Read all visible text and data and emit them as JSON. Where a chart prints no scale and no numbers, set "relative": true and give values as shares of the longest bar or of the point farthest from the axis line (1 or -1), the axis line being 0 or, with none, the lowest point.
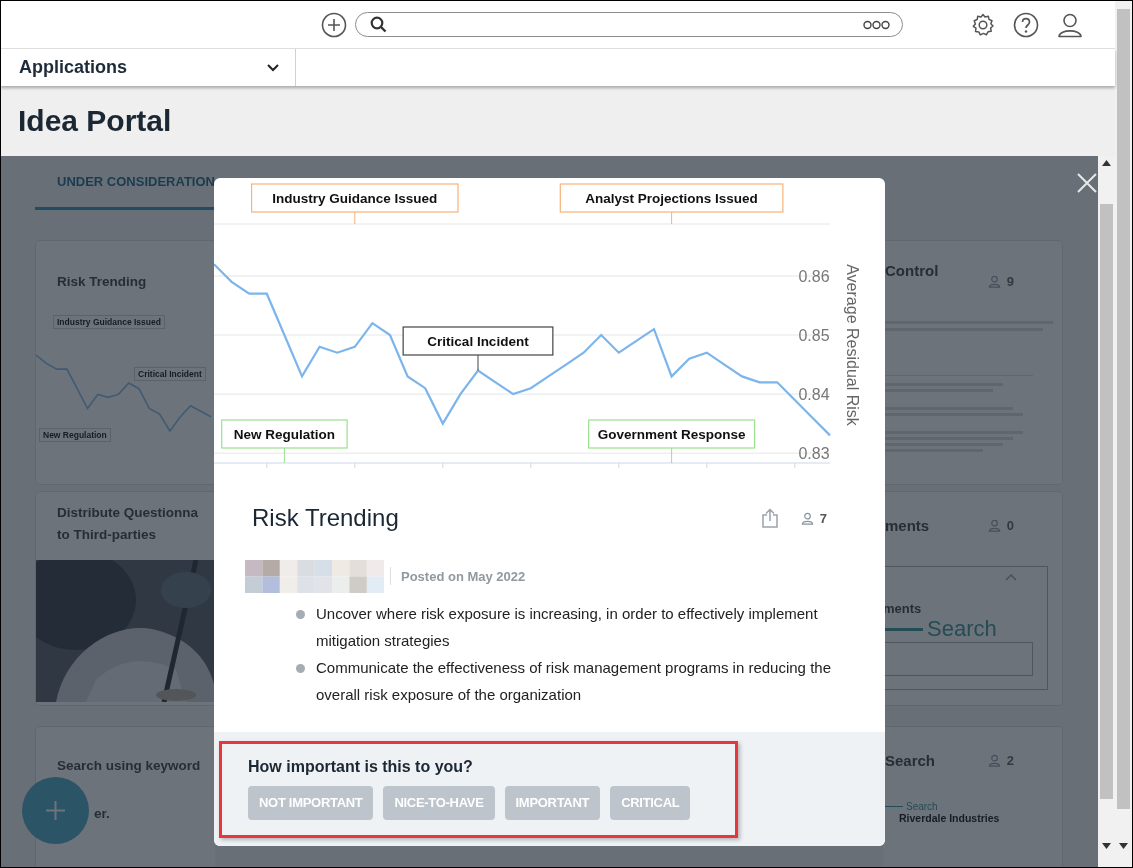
{
  "app_menu": {
    "label": "Applications"
  },
  "page_title": "Idea Portal",
  "tabs": [
    {
      "label": "UNDER CONSIDERATION",
      "selected": true
    }
  ],
  "left_cards": [
    {
      "kind": "chart",
      "title_lines": [
        "Risk Trending"
      ],
      "labels": [
        "Industry Guidance Issued",
        "Critical Incident",
        "New Regulation"
      ],
      "chart_data": {
        "type": "line",
        "relative": true,
        "categories": [
          null,
          null,
          null,
          null,
          null,
          null,
          null,
          null,
          null,
          null,
          null,
          null,
          null,
          null,
          null,
          null,
          null,
          null
        ],
        "series": [
          {
            "color": "#405a74",
            "values": [
              1,
              0.889,
              0.815,
              0.815,
              0.556,
              0.296,
              0.481,
              0.444,
              0.481,
              0.63,
              0.556,
              0.296,
              0.222,
              0,
              0.185,
              0.333,
              0.259,
              0.185
            ]
          }
        ]
      }
    },
    {
      "kind": "picture",
      "title_lines": [
        "Distribute Questionna",
        "to Third-parties"
      ]
    },
    {
      "kind": "text",
      "title_lines": [
        "Search using keyword",
        "er."
      ]
    }
  ],
  "right_cards": [
    {
      "kind": "text",
      "title": "Control",
      "votes": "9"
    },
    {
      "kind": "panel",
      "title": "ments",
      "votes": "0",
      "panel_title": "ments",
      "panel_search": "Search"
    },
    {
      "kind": "tabs",
      "title": "Search",
      "votes": "2",
      "panel_search": "Search",
      "panel_title": "Riverdale Industries"
    }
  ],
  "modal": {
    "chart_data": {
      "type": "line",
      "ylabel": "Average Residual Risk",
      "grid": true,
      "categories": [
        null,
        null,
        null,
        null,
        null,
        null,
        null,
        null,
        null,
        null,
        null,
        null,
        null,
        null,
        null,
        null,
        null,
        null,
        null,
        null,
        null,
        null,
        null,
        null,
        null,
        null,
        null,
        null,
        null,
        null,
        null,
        null,
        null,
        null,
        null,
        null
      ],
      "series": [
        {
          "color": "#7cb5ec",
          "values": [
            0.862,
            0.859,
            0.857,
            0.857,
            0.85,
            0.843,
            0.848,
            0.847,
            0.848,
            0.852,
            0.85,
            0.843,
            0.841,
            0.835,
            0.84,
            0.844,
            0.842,
            0.84,
            0.841,
            0.843,
            0.845,
            0.847,
            0.85,
            0.847,
            0.849,
            0.851,
            0.843,
            0.846,
            0.847,
            0.845,
            0.843,
            0.842,
            0.842,
            0.839,
            0.836,
            0.833
          ]
        }
      ],
      "ylim": [
        0.8285,
        0.8688
      ],
      "yticks": [
        {
          "value": 0.83,
          "label": "0.83"
        },
        {
          "value": 0.84,
          "label": "0.84"
        },
        {
          "value": 0.85,
          "label": "0.85"
        },
        {
          "value": 0.86,
          "label": "0.86"
        }
      ],
      "annotations": [
        "Industry Guidance Issued",
        "Analyst Projections Issued",
        "Critical Incident",
        "New Regulation",
        "Government Response"
      ]
    },
    "title": "Risk Trending",
    "votes": "7",
    "posted": "Posted on May 2022",
    "bullets": [
      "Uncover where risk exposure is increasing, in order to effectively implement mitigation strategies",
      "Communicate the effectiveness of risk management programs in reducing the overall risk exposure of the organization"
    ],
    "question": "How important is this to you?",
    "options": [
      {
        "label": "NOT IMPORTANT",
        "selected": false
      },
      {
        "label": "NICE-TO-HAVE",
        "selected": false
      },
      {
        "label": "IMPORTANT",
        "selected": false
      },
      {
        "label": "CRITICAL",
        "selected": false
      }
    ]
  }
}
